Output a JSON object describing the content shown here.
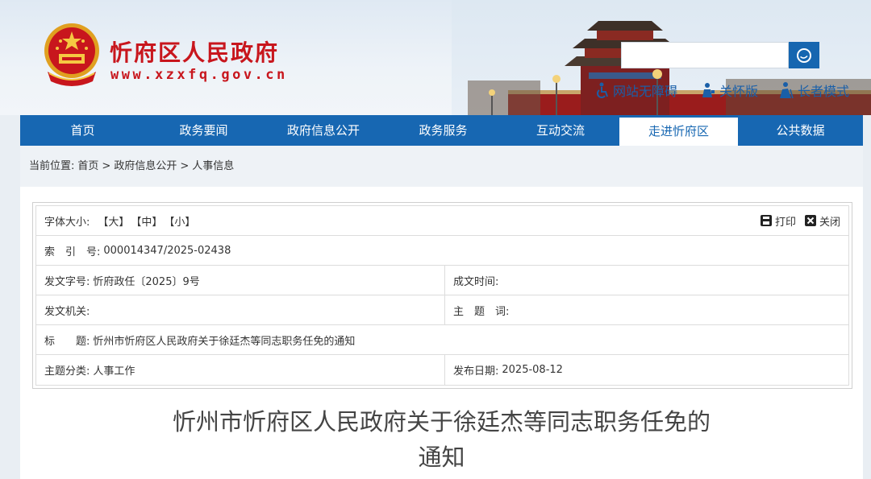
{
  "header": {
    "site_name": "忻府区人民政府",
    "site_url": "www.xzxfq.gov.cn",
    "search": {
      "placeholder": ""
    },
    "tools": [
      {
        "label": "网站无障碍",
        "icon": "accessibility-icon"
      },
      {
        "label": "关怀版",
        "icon": "care-person-icon"
      },
      {
        "label": "长者模式",
        "icon": "elder-person-icon"
      }
    ]
  },
  "nav": {
    "items": [
      {
        "label": "首页",
        "active": false
      },
      {
        "label": "政务要闻",
        "active": false
      },
      {
        "label": "政府信息公开",
        "active": false
      },
      {
        "label": "政务服务",
        "active": false
      },
      {
        "label": "互动交流",
        "active": false
      },
      {
        "label": "走进忻府区",
        "active": true
      },
      {
        "label": "公共数据",
        "active": false
      }
    ]
  },
  "breadcrumb": {
    "prefix": "当前位置:",
    "items": [
      "首页",
      "政府信息公开",
      "人事信息"
    ],
    "sep": ">"
  },
  "info": {
    "font_size_label": "字体大小:",
    "font_sizes": [
      "【大】",
      "【中】",
      "【小】"
    ],
    "print_label": "打印",
    "close_label": "关闭",
    "index_label": "索　引　号:",
    "index_value": "000014347/2025-02438",
    "doc_no_label": "发文字号:",
    "doc_no_value": "忻府政任〔2025〕9号",
    "created_label": "成文时间:",
    "created_value": "",
    "issuer_label": "发文机关:",
    "issuer_value": "",
    "keywords_label": "主　题　词:",
    "keywords_value": "",
    "title_label": "标　　题:",
    "title_value": "忻州市忻府区人民政府关于徐廷杰等同志职务任免的通知",
    "category_label": "主题分类:",
    "category_value": "人事工作",
    "pub_date_label": "发布日期:",
    "pub_date_value": "2025-08-12"
  },
  "document": {
    "title_line1": "忻州市忻府区人民政府关于徐廷杰等同志职务任免的",
    "title_line2": "通知"
  },
  "colors": {
    "brand_red": "#c8161d",
    "nav_blue": "#1767b2",
    "link_blue": "#1a5fa8"
  }
}
